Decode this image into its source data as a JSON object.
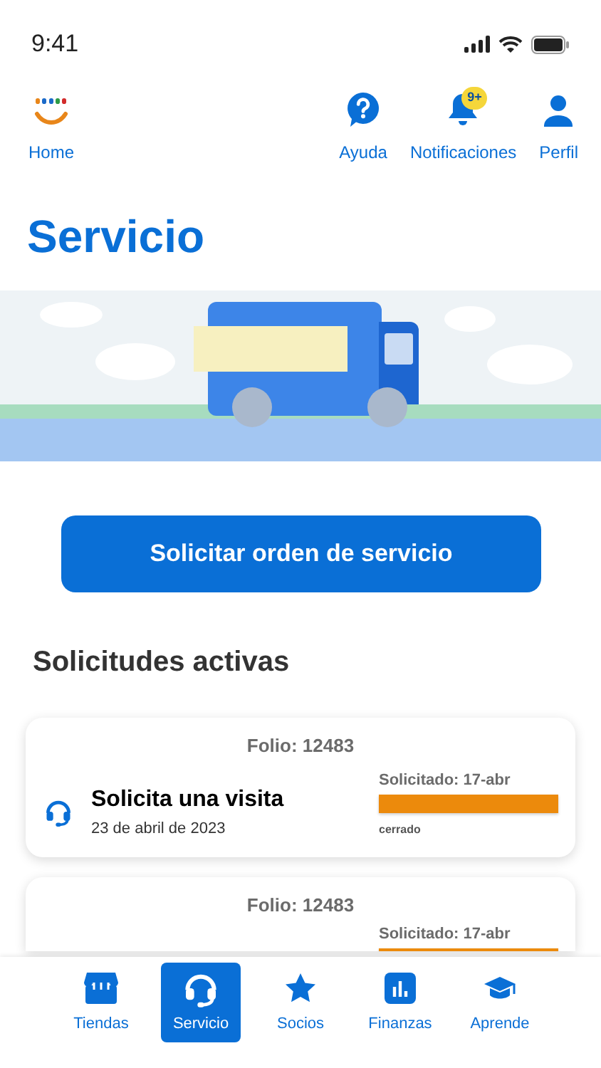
{
  "status_bar": {
    "time": "9:41"
  },
  "header": {
    "home": "Home",
    "actions": [
      {
        "kind": "help",
        "label": "Ayuda"
      },
      {
        "kind": "bell",
        "label": "Notificaciones",
        "badge": "9+"
      },
      {
        "kind": "person",
        "label": "Perfil"
      }
    ]
  },
  "title": "Servicio",
  "primary_button": "Solicitar orden de servicio",
  "section_title": "Solicitudes activas",
  "requests": [
    {
      "folio": "Folio: 12483",
      "title": "Solicita una visita",
      "date": "23 de abril de 2023",
      "requested": "Solicitado: 17-abr",
      "level": 1,
      "status": "cerrado"
    },
    {
      "folio": "Folio: 12483",
      "requested": "Solicitado: 17-abr",
      "level": 1
    }
  ],
  "bottom_nav": [
    {
      "kind": "store",
      "label": "Tiendas",
      "selected": false
    },
    {
      "kind": "headset",
      "label": "Servicio",
      "selected": true
    },
    {
      "kind": "star",
      "label": "Socios",
      "selected": false
    },
    {
      "kind": "chart",
      "label": "Finanzas",
      "selected": false
    },
    {
      "kind": "cap",
      "label": "Aprende",
      "selected": false
    }
  ]
}
